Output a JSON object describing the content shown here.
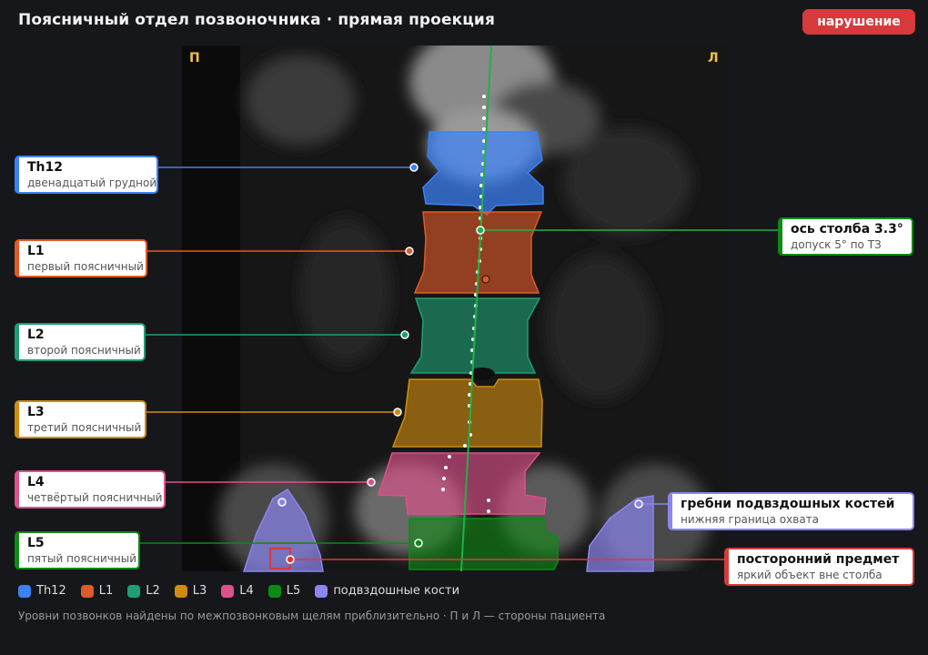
{
  "header": {
    "title": "Поясничный отдел позвоночника · прямая проекция",
    "status_badge": "нарушение"
  },
  "image": {
    "side_left": "П",
    "side_right": "Л"
  },
  "colors": {
    "th12": "#3b82f6",
    "l1": "#e05a2a",
    "l2": "#1f9e74",
    "l3": "#d08c10",
    "l4": "#e0508a",
    "l5": "#0f8a14",
    "iliac": "#8b86f0",
    "axis": "#22b04a",
    "foreign": "#d83a3a",
    "badge": "#d8393c"
  },
  "labels": {
    "th12": {
      "name": "Th12",
      "desc": "двенадцатый грудной"
    },
    "l1": {
      "name": "L1",
      "desc": "первый поясничный"
    },
    "l2": {
      "name": "L2",
      "desc": "второй поясничный"
    },
    "l3": {
      "name": "L3",
      "desc": "третий поясничный"
    },
    "l4": {
      "name": "L4",
      "desc": "четвёртый поясничный"
    },
    "l5": {
      "name": "L5",
      "desc": "пятый поясничный"
    },
    "axis": {
      "name": "ось столба 3.3°",
      "desc": "допуск 5° по ТЗ"
    },
    "iliac": {
      "name": "гребни подвздошных костей",
      "desc": "нижняя граница охвата"
    },
    "foreign": {
      "name": "посторонний предмет",
      "desc": "яркий объект вне столба"
    }
  },
  "legend": [
    {
      "label": "Th12",
      "color_key": "th12"
    },
    {
      "label": "L1",
      "color_key": "l1"
    },
    {
      "label": "L2",
      "color_key": "l2"
    },
    {
      "label": "L3",
      "color_key": "l3"
    },
    {
      "label": "L4",
      "color_key": "l4"
    },
    {
      "label": "L5",
      "color_key": "l5"
    },
    {
      "label": "подвздошные кости",
      "color_key": "iliac"
    }
  ],
  "footer": {
    "note": "Уровни позвонков найдены по межпозвонковым щелям приблизительно · П и Л — стороны пациента"
  }
}
